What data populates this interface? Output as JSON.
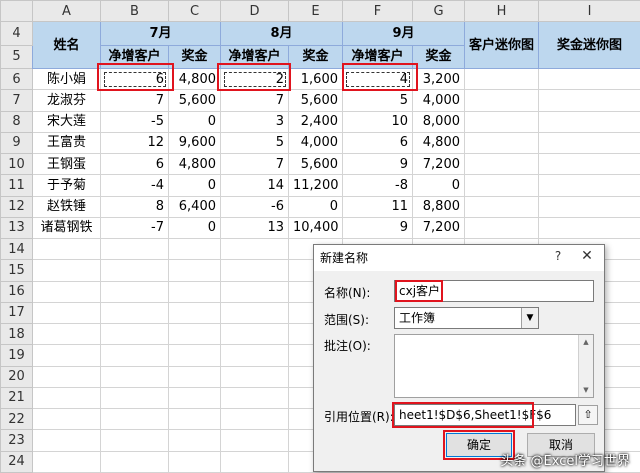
{
  "columns": [
    "A",
    "B",
    "C",
    "D",
    "E",
    "F",
    "G",
    "H",
    "I"
  ],
  "row_numbers": [
    "4",
    "5",
    "6",
    "7",
    "8",
    "9",
    "10",
    "11",
    "12",
    "13",
    "14",
    "15",
    "16",
    "17",
    "18",
    "19",
    "20",
    "21",
    "22",
    "23",
    "24"
  ],
  "header": {
    "name": "姓名",
    "months": [
      "7月",
      "8月",
      "9月"
    ],
    "sub_net": "净增客户",
    "sub_bonus": "奖金",
    "spark_cust": "客户迷你图",
    "spark_bonus": "奖金迷你图"
  },
  "rows": [
    {
      "name": "陈小娟",
      "v": [
        "6",
        "4,800",
        "2",
        "1,600",
        "4",
        "3,200"
      ]
    },
    {
      "name": "龙淑芬",
      "v": [
        "7",
        "5,600",
        "7",
        "5,600",
        "5",
        "4,000"
      ]
    },
    {
      "name": "宋大莲",
      "v": [
        "-5",
        "0",
        "3",
        "2,400",
        "10",
        "8,000"
      ]
    },
    {
      "name": "王富贵",
      "v": [
        "12",
        "9,600",
        "5",
        "4,000",
        "6",
        "4,800"
      ]
    },
    {
      "name": "王钢蛋",
      "v": [
        "6",
        "4,800",
        "7",
        "5,600",
        "9",
        "7,200"
      ]
    },
    {
      "name": "于予菊",
      "v": [
        "-4",
        "0",
        "14",
        "11,200",
        "-8",
        "0"
      ]
    },
    {
      "name": "赵铁锤",
      "v": [
        "8",
        "6,400",
        "-6",
        "0",
        "11",
        "8,800"
      ]
    },
    {
      "name": "诸葛钢铁",
      "v": [
        "-7",
        "0",
        "13",
        "10,400",
        "9",
        "7,200"
      ]
    }
  ],
  "dialog": {
    "title": "新建名称",
    "help": "?",
    "close": "✕",
    "name_label": "名称(N):",
    "name_value": "cxj客户",
    "scope_label": "范围(S):",
    "scope_value": "工作簿",
    "comment_label": "批注(O):",
    "ref_label": "引用位置(R):",
    "ref_value": "heet1!$D$6,Sheet1!$F$6",
    "ok": "确定",
    "cancel": "取消"
  },
  "watermark": "头条 @Excel学习世界",
  "colors": {
    "header_blue": "#bdd7ee",
    "highlight_red": "#e0141e"
  }
}
